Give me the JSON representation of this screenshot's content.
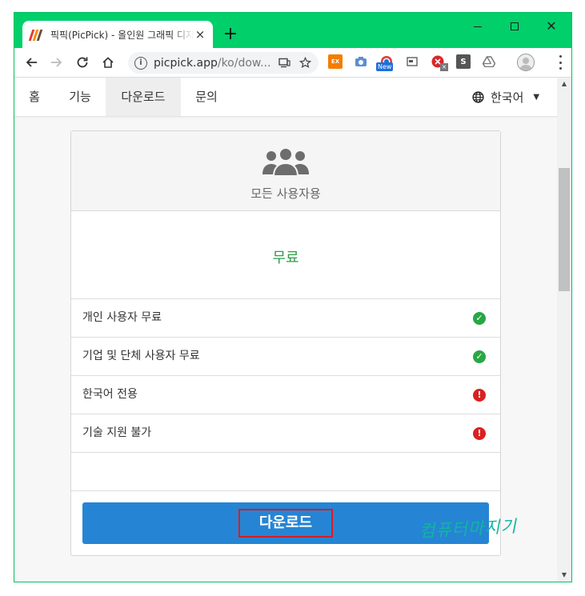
{
  "browser": {
    "tab_title": "픽픽(PicPick) - 올인원 그래픽 디자인 도구",
    "tab_close": "×",
    "new_tab": "+",
    "window_close": "✕",
    "url_host": "picpick.app",
    "url_path": "/ko/dow...",
    "extensions": {
      "ex_label": "EX",
      "new_badge": "New",
      "s_label": "S"
    }
  },
  "site_nav": {
    "items": [
      {
        "label": "홈"
      },
      {
        "label": "기능"
      },
      {
        "label": "다운로드"
      },
      {
        "label": "문의"
      }
    ],
    "active_index": 2,
    "language": "한국어"
  },
  "plan": {
    "header_label": "모든 사용자용",
    "price": "무료",
    "features": [
      {
        "label": "개인 사용자 무료",
        "status": "ok"
      },
      {
        "label": "기업 및 단체 사용자 무료",
        "status": "ok"
      },
      {
        "label": "한국어 전용",
        "status": "bad"
      },
      {
        "label": "기술 지원 불가",
        "status": "bad"
      }
    ],
    "download_label": "다운로드"
  },
  "watermark": "컴퓨터마지기",
  "colors": {
    "titlebar": "#00cf6a",
    "price": "#2e9e4a",
    "download_button": "#2585d4",
    "highlight_box": "#e0191e",
    "ok_icon": "#28a745",
    "bad_icon": "#d92121"
  }
}
